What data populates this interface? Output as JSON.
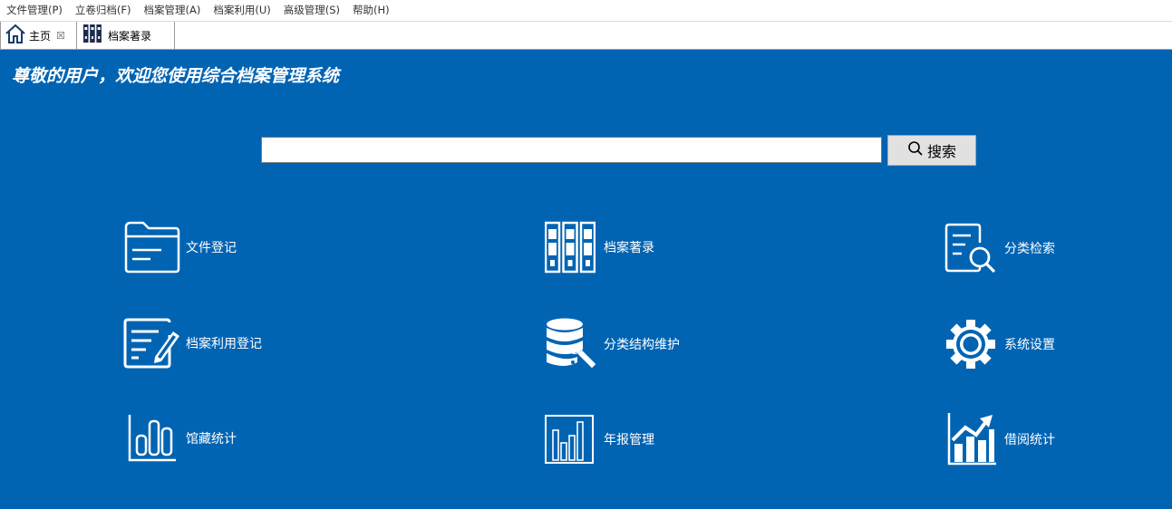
{
  "menubar": {
    "items": [
      "文件管理(P)",
      "立卷归档(F)",
      "档案管理(A)",
      "档案利用(U)",
      "高级管理(S)",
      "帮助(H)"
    ]
  },
  "tabs": {
    "home": {
      "label": "主页",
      "close": "☒",
      "icon": "home-icon"
    },
    "catalog": {
      "label": "档案著录",
      "icon": "binders-icon"
    }
  },
  "main": {
    "welcome": "尊敬的用户，欢迎您使用综合档案管理系统",
    "search": {
      "value": "",
      "button_label": "搜索",
      "icon": "search-icon"
    },
    "background": "#0164b3",
    "features": [
      {
        "label": "文件登记",
        "icon": "folder-icon"
      },
      {
        "label": "档案著录",
        "icon": "binders-icon"
      },
      {
        "label": "分类检索",
        "icon": "document-search-icon"
      },
      {
        "label": "档案利用登记",
        "icon": "edit-document-icon"
      },
      {
        "label": "分类结构维护",
        "icon": "database-wrench-icon"
      },
      {
        "label": "系统设置",
        "icon": "gear-icon"
      },
      {
        "label": "馆藏统计",
        "icon": "bar-chart-icon"
      },
      {
        "label": "年报管理",
        "icon": "framed-chart-icon"
      },
      {
        "label": "借阅统计",
        "icon": "trend-chart-icon"
      }
    ]
  }
}
